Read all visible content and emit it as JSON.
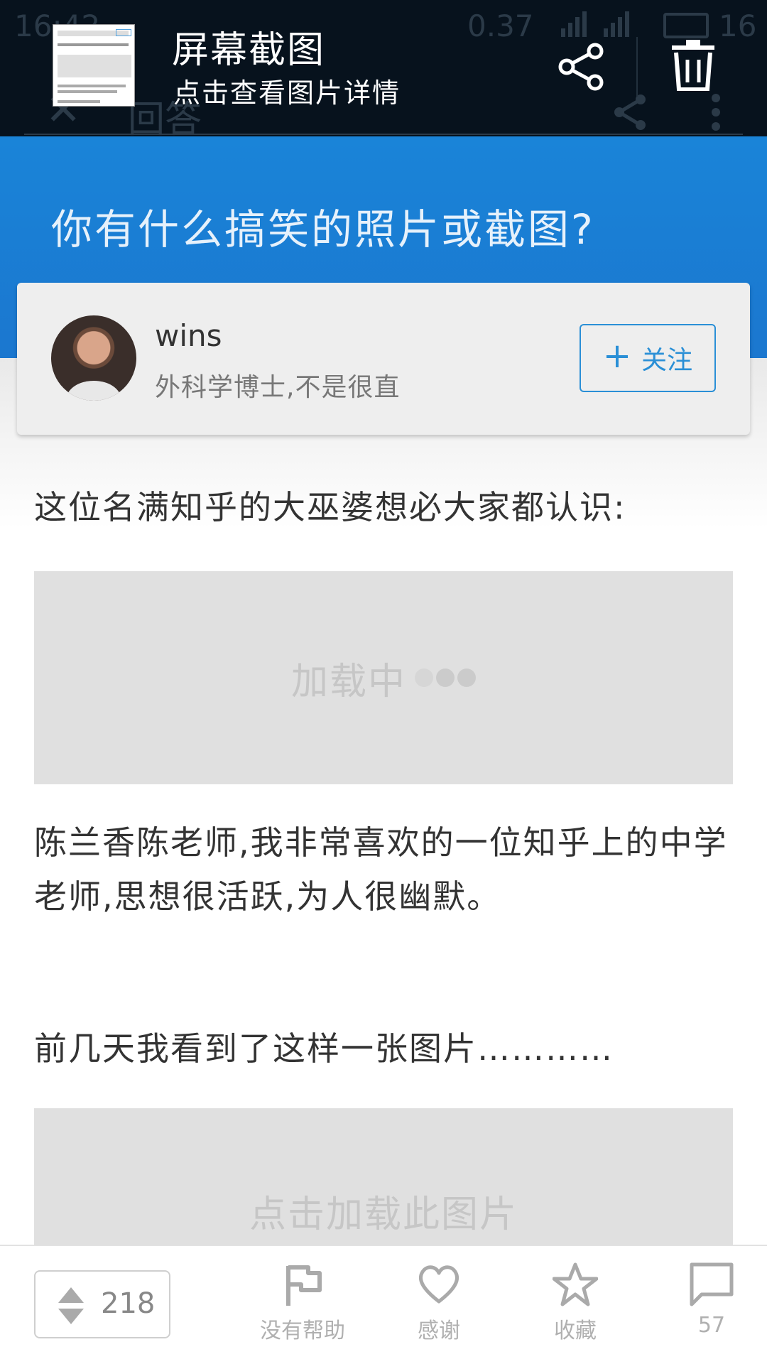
{
  "status_bar": {
    "time": "16:42",
    "speed": "0.37",
    "battery": "16"
  },
  "app_toolbar": {
    "title": "回答"
  },
  "notification": {
    "title": "屏幕截图",
    "subtitle": "点击查看图片详情",
    "share_icon": "share-icon",
    "delete_icon": "trash-icon"
  },
  "question": {
    "title": "你有什么搞笑的照片或截图?"
  },
  "author": {
    "name": "wins",
    "bio": "外科学博士,不是很直",
    "follow_label": "关注"
  },
  "content": {
    "paragraph1": "这位名满知乎的大巫婆想必大家都认识:",
    "image1_status": "加载中",
    "paragraph2": "陈兰香陈老师,我非常喜欢的一位知乎上的中学老师,思想很活跃,为人很幽默。",
    "paragraph3": "前几天我看到了这样一张图片…………",
    "image2_status": "点击加载此图片"
  },
  "bottom_bar": {
    "vote_count": "218",
    "not_helpful": "没有帮助",
    "thanks": "感谢",
    "collect": "收藏",
    "comments": "57"
  },
  "colors": {
    "header_blue": "#1b7ed4",
    "notif_bg": "#07121d",
    "follow_blue": "#2a8fd6"
  }
}
